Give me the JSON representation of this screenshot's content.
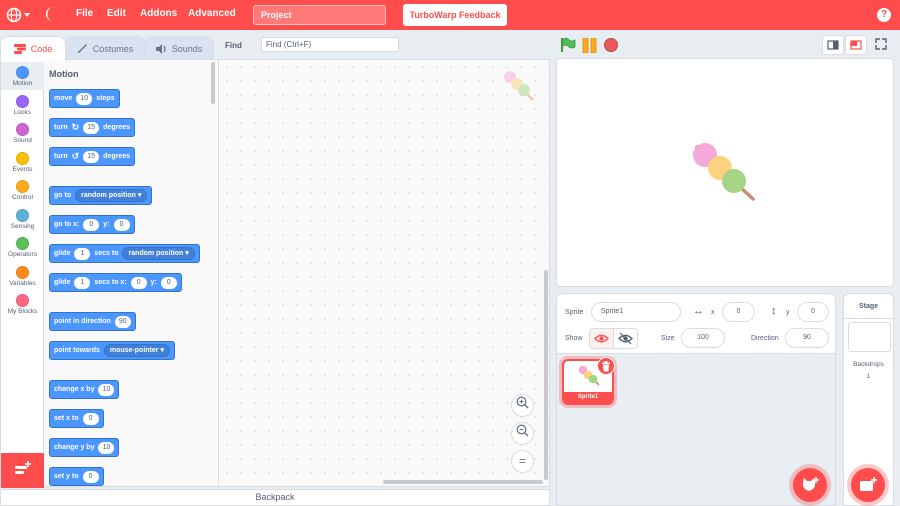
{
  "menubar": {
    "menus": [
      "File",
      "Edit",
      "Addons",
      "Advanced"
    ],
    "project_title": "Project",
    "feedback_label": "TurboWarp Feedback",
    "help_label": "?"
  },
  "tabs": {
    "code": "Code",
    "costumes": "Costumes",
    "sounds": "Sounds"
  },
  "find": {
    "label": "Find",
    "placeholder": "Find (Ctrl+F)"
  },
  "categories": [
    {
      "label": "Motion",
      "color": "#4c97ff"
    },
    {
      "label": "Looks",
      "color": "#9966ff"
    },
    {
      "label": "Sound",
      "color": "#cf63cf"
    },
    {
      "label": "Events",
      "color": "#ffbf00"
    },
    {
      "label": "Control",
      "color": "#ffab19"
    },
    {
      "label": "Sensing",
      "color": "#5cb1d6"
    },
    {
      "label": "Operators",
      "color": "#59c059"
    },
    {
      "label": "Variables",
      "color": "#ff8c1a"
    },
    {
      "label": "My Blocks",
      "color": "#ff6680"
    }
  ],
  "palette": {
    "section_title": "Motion",
    "move": {
      "a": "move",
      "n": "10",
      "b": "steps"
    },
    "turn_right": {
      "a": "turn",
      "n": "15",
      "b": "degrees"
    },
    "turn_left": {
      "a": "turn",
      "n": "15",
      "b": "degrees"
    },
    "goto": {
      "a": "go to",
      "dd": "random position"
    },
    "goto_xy": {
      "a": "go to x:",
      "x": "0",
      "yl": "y:",
      "y": "0"
    },
    "glide_to": {
      "a": "glide",
      "n": "1",
      "b": "secs to",
      "dd": "random position"
    },
    "glide_xy": {
      "a": "glide",
      "n": "1",
      "b": "secs to x:",
      "x": "0",
      "yl": "y:",
      "y": "0"
    },
    "point_dir": {
      "a": "point in direction",
      "n": "90"
    },
    "point_towards": {
      "a": "point towards",
      "dd": "mouse-pointer"
    },
    "change_x": {
      "a": "change x by",
      "n": "10"
    },
    "set_x": {
      "a": "set x to",
      "n": "0"
    },
    "change_y": {
      "a": "change y by",
      "n": "10"
    },
    "set_y": {
      "a": "set y to",
      "n": "0"
    }
  },
  "workspace": {
    "zoom_reset_label": "="
  },
  "backpack_label": "Backpack",
  "sprite_info": {
    "sprite_label": "Sprite",
    "sprite_name": "Sprite1",
    "x_label": "x",
    "x_value": "0",
    "y_label": "y",
    "y_value": "0",
    "show_label": "Show",
    "size_label": "Size",
    "size_value": "100",
    "direction_label": "Direction",
    "direction_value": "90"
  },
  "sprites": [
    {
      "name": "Sprite1"
    }
  ],
  "stage_selector": {
    "title": "Stage",
    "backdrops_label": "Backdrops",
    "backdrops_count": "1"
  },
  "colors": {
    "accent": "#ff4c4c",
    "motion": "#4c97ff"
  }
}
